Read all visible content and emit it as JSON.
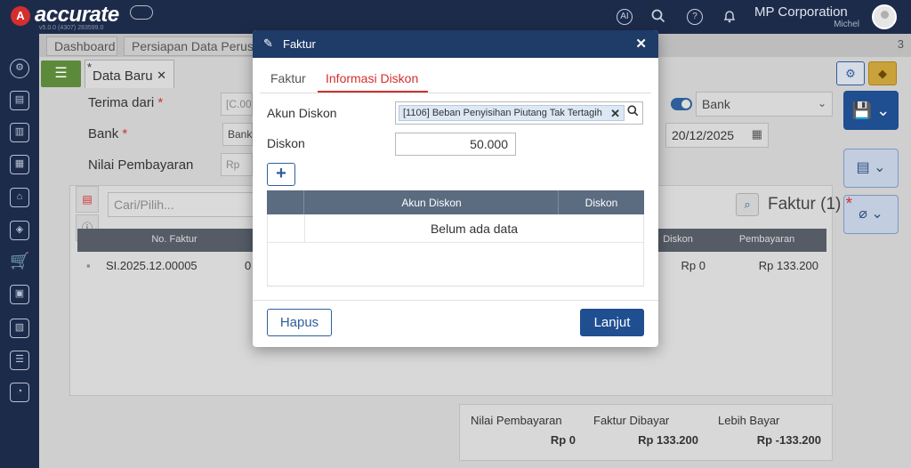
{
  "app": {
    "logo_letter": "A",
    "logo_text": "accurate",
    "version": "v5.0.0 (4307) 283599.0",
    "company": "MP Corporation",
    "user": "Michel",
    "top_icons": [
      "ai-icon",
      "search-icon",
      "help-icon",
      "bell-icon"
    ]
  },
  "tabs": [
    {
      "label": "Dashboard"
    },
    {
      "label": "Persiapan Data Perusahaan"
    }
  ],
  "tab_count": "3",
  "doc_tab": {
    "label": "Data Baru",
    "modified_mark": "*"
  },
  "form": {
    "terima_dari_label": "Terima dari",
    "terima_dari_value": "[C.00",
    "bank_label": "Bank",
    "bank_value": "Bank",
    "nilai_label": "Nilai Pembayaran",
    "nilai_value": "Rp",
    "bank_select": "Bank",
    "date": "20/12/2025"
  },
  "panel": {
    "search_placeholder": "Cari/Pilih...",
    "faktur_title": "Faktur (1)",
    "columns": [
      "No. Faktur",
      "Diskon",
      "Pembayaran"
    ],
    "rows": [
      {
        "no": "SI.2025.12.00005",
        "partial": "0",
        "diskon": "Rp 0",
        "pembayaran": "Rp 133.200"
      }
    ]
  },
  "footer": {
    "nilai_label": "Nilai Pembayaran",
    "nilai_value": "Rp 0",
    "faktur_label": "Faktur Dibayar",
    "faktur_value": "Rp 133.200",
    "lebih_label": "Lebih Bayar",
    "lebih_value": "Rp -133.200"
  },
  "modal": {
    "title": "Faktur",
    "tabs": [
      "Faktur",
      "Informasi Diskon"
    ],
    "active_tab": "Informasi Diskon",
    "akun_label": "Akun Diskon",
    "akun_value": "[1106] Beban Penyisihan Piutang Tak Tertagih",
    "diskon_label": "Diskon",
    "diskon_value": "50.000",
    "add_label": "+",
    "table_columns": [
      "Akun Diskon",
      "Diskon"
    ],
    "empty_text": "Belum ada data",
    "hapus_label": "Hapus",
    "lanjut_label": "Lanjut"
  },
  "colors": {
    "header_navy": "#1d2b4b",
    "modal_header": "#1f3b68",
    "accent_red": "#d32f2f",
    "primary_blue": "#1f4e91"
  }
}
